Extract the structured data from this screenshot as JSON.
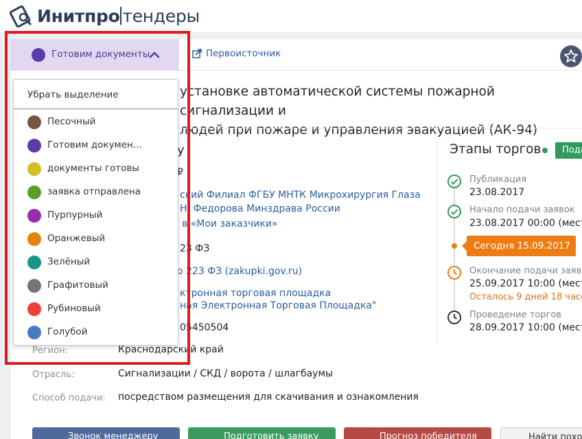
{
  "header": {
    "brand_bold": "Инитпро",
    "brand_thin": "тендеры"
  },
  "tabs": {
    "status_label": "Готовим документы",
    "status_color": "#5b3aa8",
    "source_label": "Первоисточник"
  },
  "tender": {
    "title_line1": "установке автоматической системы пожарной сигнализации и",
    "title_line2": "людей при пожаре и управления эвакуацией (АК-94)"
  },
  "details": {
    "price_fragment": "у",
    "currency_fragment": "₽",
    "customer_line1": "ский Филиал ФГБУ МНТК Микрохирургия Глаза",
    "customer_line2": "Н. Федорова Минздрава России",
    "my_customers_link": "в «Мои заказчики»",
    "law": "23 ФЗ",
    "law_link": "о 223 ФЗ (zakupki.gov.ru)",
    "platform_line1": "ктронная торговая площадка",
    "platform_line2": "ная Электронная Торговая Площадка\"",
    "number": "05450504",
    "region_label": "Регион:",
    "region_value": "Краснодарский край",
    "industry_label": "Отрасль:",
    "industry_value": "Сигнализации / СКД / ворота / шлагбаумы",
    "submission_label": "Способ подачи:",
    "submission_value": "посредством размещения для скачивания и ознакомления"
  },
  "stages": {
    "title": "Этапы торгов",
    "badge": "Пода",
    "items": [
      {
        "label": "Публикация",
        "value": "23.08.2017",
        "icon": "check-circle-icon"
      },
      {
        "label": "Начало подачи заявок",
        "value": "23.08.2017 00:00 (местно",
        "icon": "check-circle-icon"
      },
      {
        "label": "Окончание подачи заявок",
        "value": "25.09.2017 10:00 (местно",
        "warn": "Осталось 9 дней 18 часов",
        "icon": "clock-orange-icon"
      },
      {
        "label": "Проведение торгов",
        "value": "28.09.2017 10:00 (местно",
        "icon": "clock-dark-icon"
      }
    ],
    "today": "Сегодня 15.09.2017"
  },
  "dropdown": {
    "clear_label": "Убрать выделение",
    "items": [
      {
        "label": "Песочный",
        "color": "#7a5346"
      },
      {
        "label": "Готовим докумен...",
        "color": "#5b3aa8"
      },
      {
        "label": "документы готовы",
        "color": "#d2bf25"
      },
      {
        "label": "заявка отправлена",
        "color": "#5a9e2a"
      },
      {
        "label": "Пурпурный",
        "color": "#9c2ab0"
      },
      {
        "label": "Оранжевый",
        "color": "#e2830a"
      },
      {
        "label": "Зелёный",
        "color": "#1a9485"
      },
      {
        "label": "Графитовый",
        "color": "#757575"
      },
      {
        "label": "Рубиновый",
        "color": "#ee3f3a"
      },
      {
        "label": "Голубой",
        "color": "#4b79c4"
      }
    ]
  },
  "buttons": {
    "call_manager": "Звонок менеджеру",
    "prepare_application": "Подготовить заявку",
    "winner_forecast": "Прогноз победителя",
    "find_similar": "Найти похож"
  },
  "colors": {
    "highlight": "#e0191e",
    "accent_green": "#2f9a5d",
    "accent_orange": "#ee7c14"
  }
}
